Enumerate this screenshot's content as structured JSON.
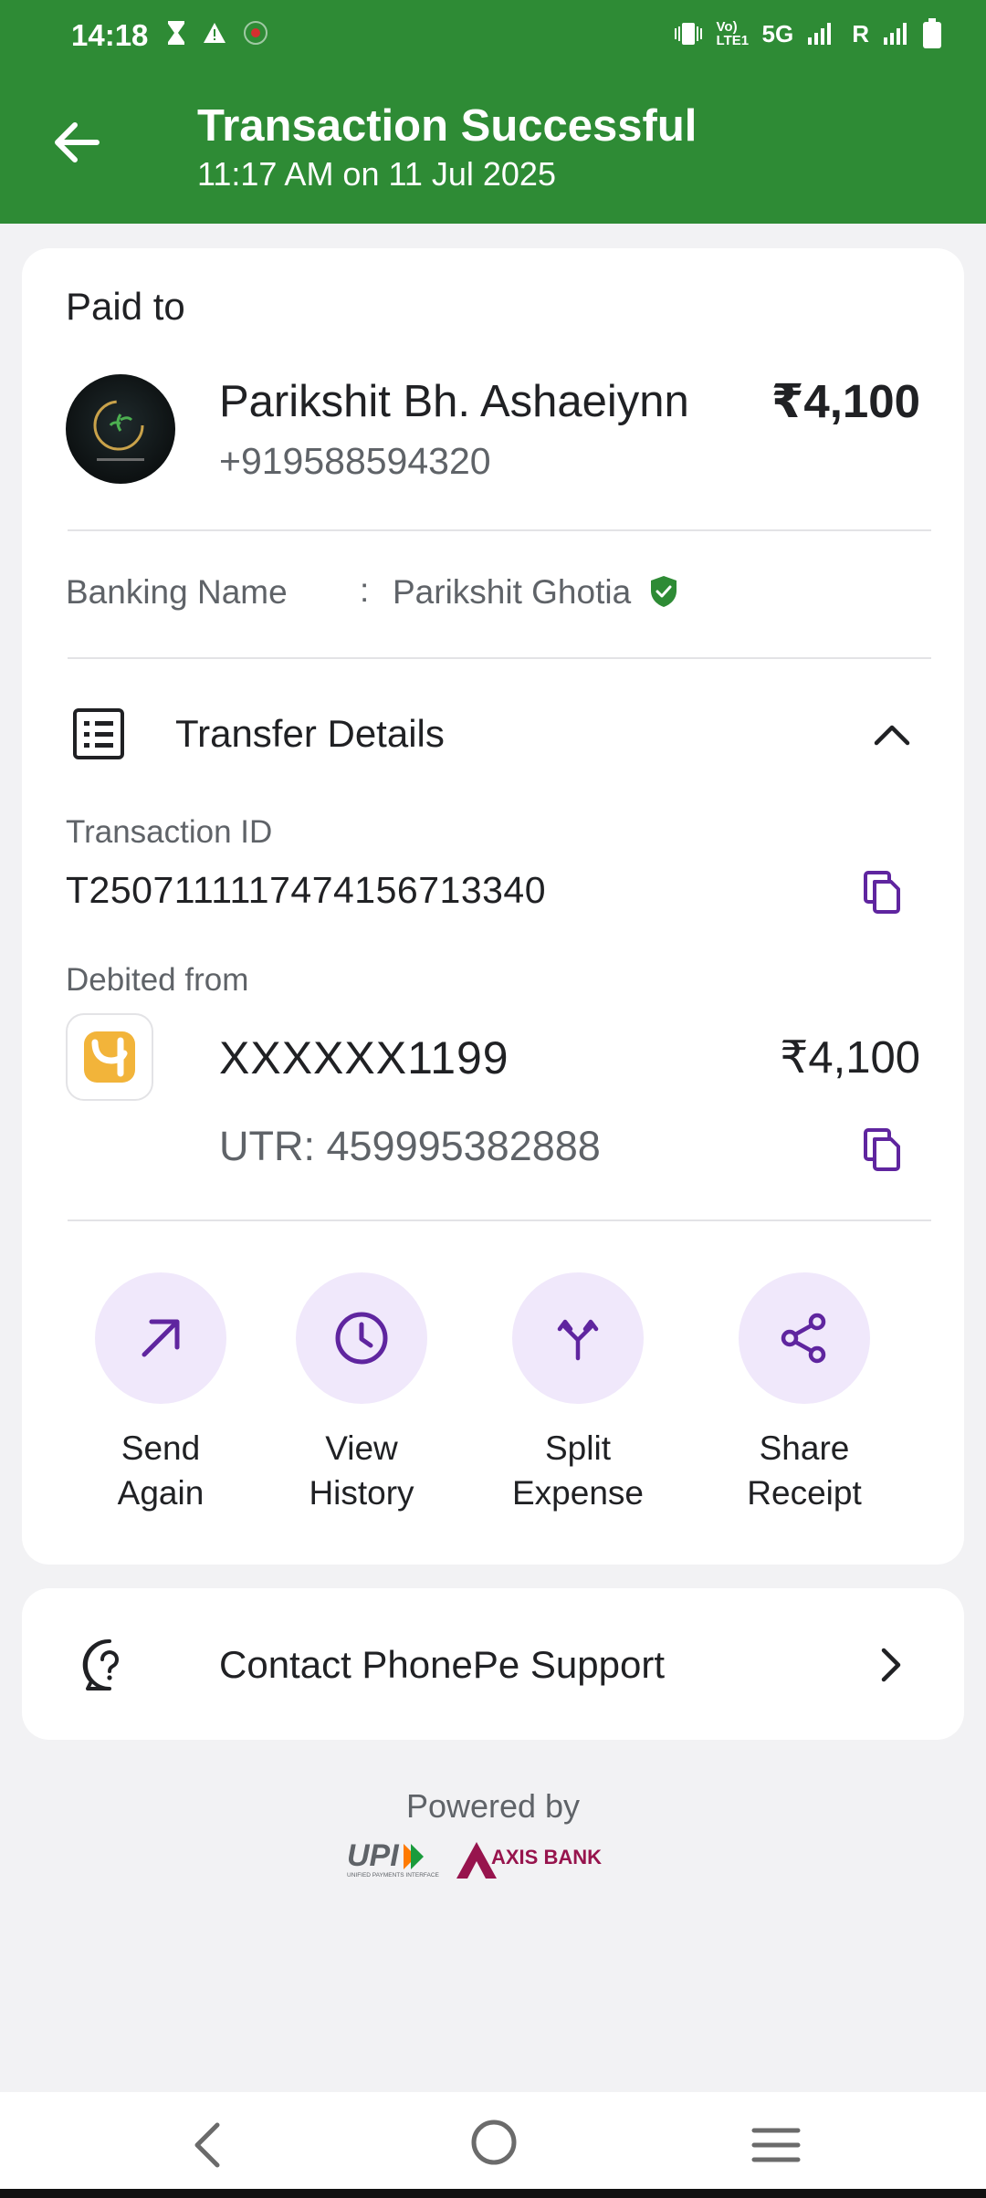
{
  "status_bar": {
    "time": "14:18",
    "network": "5G",
    "roaming": "R",
    "volte": "Vo) LTE1"
  },
  "header": {
    "title": "Transaction Successful",
    "subtitle": "11:17 AM on 11 Jul 2025",
    "background_color": "#2e8b35"
  },
  "payee": {
    "section_label": "Paid to",
    "name": "Parikshit Bh. Ashaeiynn",
    "phone": "+919588594320",
    "amount": "₹4,100",
    "banking_name_label": "Banking Name",
    "banking_name_separator": ":",
    "banking_name_value": "Parikshit Ghotia"
  },
  "transfer": {
    "title": "Transfer Details",
    "transaction_id_label": "Transaction ID",
    "transaction_id": "T2507111117474156713340",
    "debited_from_label": "Debited from",
    "account_number": "XXXXXX1199",
    "account_amount": "₹4,100",
    "utr": "UTR: 459995382888"
  },
  "actions": [
    {
      "line1": "Send",
      "line2": "Again",
      "icon": "arrow-up-right-icon"
    },
    {
      "line1": "View",
      "line2": "History",
      "icon": "clock-icon"
    },
    {
      "line1": "Split",
      "line2": "Expense",
      "icon": "split-icon"
    },
    {
      "line1": "Share",
      "line2": "Receipt",
      "icon": "share-icon"
    }
  ],
  "support": {
    "label": "Contact PhonePe Support"
  },
  "footer": {
    "powered_by": "Powered by",
    "upi_logo_text": "UPI",
    "upi_logo_subtext": "UNIFIED PAYMENTS INTERFACE",
    "bank_logo_text": "AXIS BANK"
  },
  "colors": {
    "accent_purple": "#5f259f",
    "action_bg": "#f0e8fb",
    "success_green": "#2e8b35",
    "axis_maroon": "#97144d"
  }
}
